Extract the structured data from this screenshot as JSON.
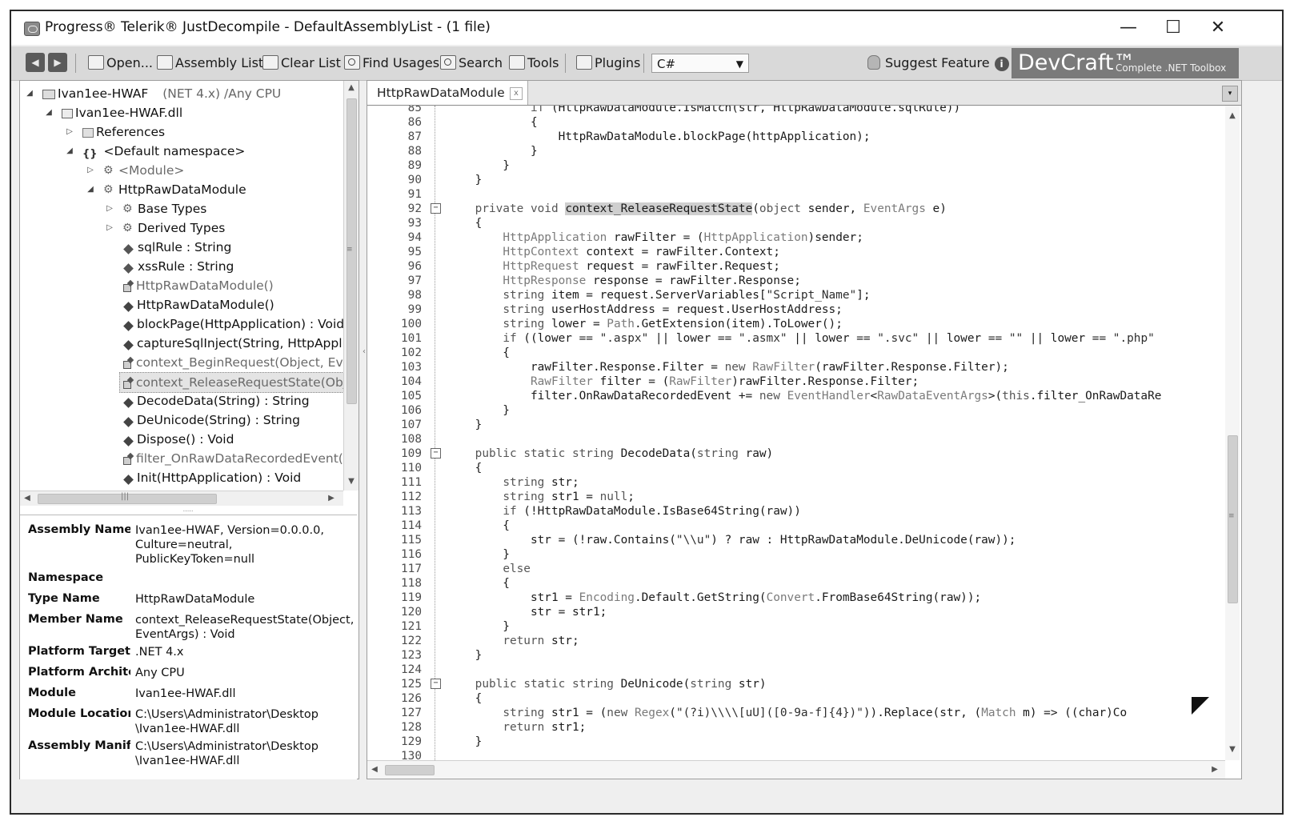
{
  "window": {
    "title": "Progress® Telerik® JustDecompile - DefaultAssemblyList - (1 file)",
    "minimize": "—",
    "maximize": "☐",
    "close": "✕"
  },
  "toolbar": {
    "back": "◀",
    "forward": "▶",
    "open": "Open...",
    "assembly_list": "Assembly List",
    "clear_list": "Clear List",
    "find_usages": "Find Usages",
    "search": "Search",
    "tools": "Tools",
    "plugins": "Plugins",
    "language": "C#",
    "suggest_feature": "Suggest Feature",
    "info": "i",
    "devcraft": {
      "name": "DevCraft™",
      "tagline": "Complete .NET Toolbox"
    }
  },
  "tree": {
    "items": [
      {
        "label": "Ivan1ee-HWAF",
        "suffix": "(NET 4.x) /Any CPU",
        "toggle": "◢"
      },
      {
        "label": "Ivan1ee-HWAF.dll",
        "toggle": "◢"
      },
      {
        "label": "References",
        "toggle": "▷"
      },
      {
        "label": "<Default namespace>",
        "icon_text": "{}",
        "toggle": "◢"
      },
      {
        "label": "<Module>",
        "toggle": "▷"
      },
      {
        "label": "HttpRawDataModule",
        "toggle": "◢"
      },
      {
        "label": "Base Types",
        "toggle": "▷"
      },
      {
        "label": "Derived Types",
        "toggle": "▷"
      },
      {
        "label": "sqlRule : String"
      },
      {
        "label": "xssRule : String"
      },
      {
        "label": "HttpRawDataModule()"
      },
      {
        "label": "HttpRawDataModule()"
      },
      {
        "label": "blockPage(HttpApplication) : Void"
      },
      {
        "label": "captureSqlInject(String, HttpApplica"
      },
      {
        "label": "context_BeginRequest(Object, Event"
      },
      {
        "label": "context_ReleaseRequestState(Objec"
      },
      {
        "label": "DecodeData(String) : String"
      },
      {
        "label": "DeUnicode(String) : String"
      },
      {
        "label": "Dispose() : Void"
      },
      {
        "label": "filter_OnRawDataRecordedEvent(Ob"
      },
      {
        "label": "Init(HttpApplication) : Void"
      }
    ],
    "scroll_up": "▲",
    "scroll_down": "▼",
    "scroll_left": "◀",
    "scroll_right": "▶",
    "grip": "|||",
    "splitter": "....."
  },
  "properties": [
    {
      "name": "Assembly Name",
      "value": [
        "Ivan1ee-HWAF, Version=0.0.0.0,",
        "Culture=neutral,",
        "PublicKeyToken=null"
      ]
    },
    {
      "name": "Namespace",
      "value": []
    },
    {
      "name": "Type Name",
      "value": [
        "HttpRawDataModule"
      ]
    },
    {
      "name": "Member Name",
      "value": [
        "context_ReleaseRequestState(Object,",
        "EventArgs) : Void"
      ]
    },
    {
      "name": "Platform Target",
      "value": [
        ".NET 4.x"
      ]
    },
    {
      "name": "Platform Architec",
      "value": [
        "Any CPU"
      ]
    },
    {
      "name": "Module",
      "value": [
        "Ivan1ee-HWAF.dll"
      ]
    },
    {
      "name": "Module Location",
      "value": [
        "C:\\Users\\Administrator\\Desktop",
        "\\Ivan1ee-HWAF.dll"
      ]
    },
    {
      "name": "Assembly Manife",
      "value": [
        "C:\\Users\\Administrator\\Desktop",
        "\\Ivan1ee-HWAF.dll"
      ]
    }
  ],
  "editor": {
    "tab_label": "HttpRawDataModule",
    "tab_close": "x",
    "tab_dropdown": "▾",
    "splitter_glyph": "‹",
    "scroll_up": "▲",
    "scroll_down": "▼",
    "scroll_left": "◀",
    "scroll_right": "▶",
    "code_lines": [
      {
        "num": "85",
        "text": "            if (HttpRawDataModule.IsMatch(str, HttpRawDataModule.sqlRule))"
      },
      {
        "num": "86",
        "text": "            {"
      },
      {
        "num": "87",
        "text": "                HttpRawDataModule.blockPage(httpApplication);"
      },
      {
        "num": "88",
        "text": "            }"
      },
      {
        "num": "89",
        "text": "        }"
      },
      {
        "num": "90",
        "text": "    }"
      },
      {
        "num": "91",
        "text": ""
      },
      {
        "num": "92",
        "text": "    private void context_ReleaseRequestState(object sender, EventArgs e)",
        "fold": "−"
      },
      {
        "num": "93",
        "text": "    {"
      },
      {
        "num": "94",
        "text": "        HttpApplication rawFilter = (HttpApplication)sender;"
      },
      {
        "num": "95",
        "text": "        HttpContext context = rawFilter.Context;"
      },
      {
        "num": "96",
        "text": "        HttpRequest request = rawFilter.Request;"
      },
      {
        "num": "97",
        "text": "        HttpResponse response = rawFilter.Response;"
      },
      {
        "num": "98",
        "text": "        string item = request.ServerVariables[\"Script_Name\"];"
      },
      {
        "num": "99",
        "text": "        string userHostAddress = request.UserHostAddress;"
      },
      {
        "num": "100",
        "text": "        string lower = Path.GetExtension(item).ToLower();"
      },
      {
        "num": "101",
        "text": "        if ((lower == \".aspx\" || lower == \".asmx\" || lower == \".svc\" || lower == \"\" || lower == \".php\""
      },
      {
        "num": "102",
        "text": "        {"
      },
      {
        "num": "103",
        "text": "            rawFilter.Response.Filter = new RawFilter(rawFilter.Response.Filter);"
      },
      {
        "num": "104",
        "text": "            RawFilter filter = (RawFilter)rawFilter.Response.Filter;"
      },
      {
        "num": "105",
        "text": "            filter.OnRawDataRecordedEvent += new EventHandler<RawDataEventArgs>(this.filter_OnRawDataRe"
      },
      {
        "num": "106",
        "text": "        }"
      },
      {
        "num": "107",
        "text": "    }"
      },
      {
        "num": "108",
        "text": ""
      },
      {
        "num": "109",
        "text": "    public static string DecodeData(string raw)",
        "fold": "−"
      },
      {
        "num": "110",
        "text": "    {"
      },
      {
        "num": "111",
        "text": "        string str;"
      },
      {
        "num": "112",
        "text": "        string str1 = null;"
      },
      {
        "num": "113",
        "text": "        if (!HttpRawDataModule.IsBase64String(raw))"
      },
      {
        "num": "114",
        "text": "        {"
      },
      {
        "num": "115",
        "text": "            str = (!raw.Contains(\"\\\\u\") ? raw : HttpRawDataModule.DeUnicode(raw));"
      },
      {
        "num": "116",
        "text": "        }"
      },
      {
        "num": "117",
        "text": "        else"
      },
      {
        "num": "118",
        "text": "        {"
      },
      {
        "num": "119",
        "text": "            str1 = Encoding.Default.GetString(Convert.FromBase64String(raw));"
      },
      {
        "num": "120",
        "text": "            str = str1;"
      },
      {
        "num": "121",
        "text": "        }"
      },
      {
        "num": "122",
        "text": "        return str;"
      },
      {
        "num": "123",
        "text": "    }"
      },
      {
        "num": "124",
        "text": ""
      },
      {
        "num": "125",
        "text": "    public static string DeUnicode(string str)",
        "fold": "−"
      },
      {
        "num": "126",
        "text": "    {"
      },
      {
        "num": "127",
        "text": "        string str1 = (new Regex(\"(?i)\\\\\\\\[uU]([0-9a-f]{4})\")).Replace(str, (Match m) => ((char)Co"
      },
      {
        "num": "128",
        "text": "        return str1;"
      },
      {
        "num": "129",
        "text": "    }"
      },
      {
        "num": "130",
        "text": ""
      }
    ]
  }
}
